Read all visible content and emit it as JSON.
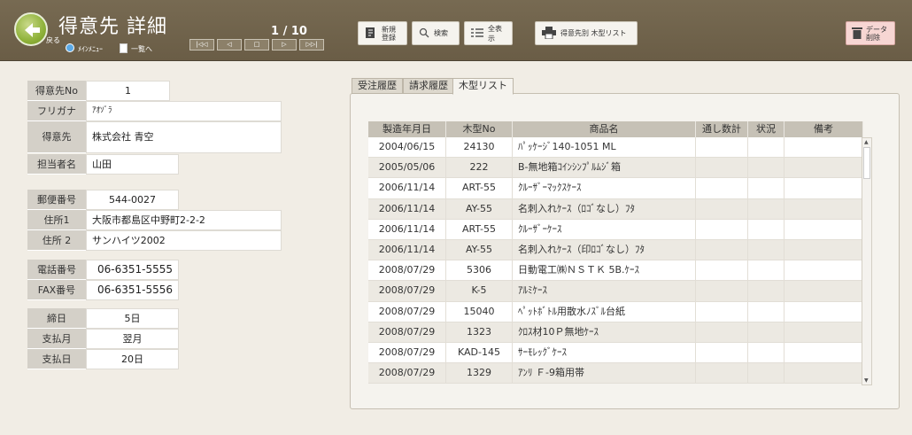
{
  "header": {
    "title": "得意先  詳細",
    "back_label": "戻る",
    "menu_link": "ﾒｲﾝﾒﾆｭｰ",
    "list_link": "一覧へ",
    "counter": "1 / 10",
    "pager": [
      "|◁◁",
      "◁",
      "□",
      "▷",
      "▷▷|"
    ],
    "new_btn": [
      "新規",
      "登録"
    ],
    "search_btn": "検索",
    "show_all_btn": "全表示",
    "print_btn": "得意先別 木型リスト",
    "delete_btn": [
      "データ",
      "削除"
    ]
  },
  "customer": {
    "no_label": "得意先No",
    "no": "1",
    "kana_label": "フリガナ",
    "kana": "ｱｵｿﾞﾗ",
    "name_label": "得意先",
    "name": "株式会社 青空",
    "staff_label": "担当者名",
    "staff": "山田",
    "zip_label": "郵便番号",
    "zip": "544-0027",
    "addr1_label": "住所1",
    "addr1": "大阪市都島区中野町2-2-2",
    "addr2_label": "住所 2",
    "addr2": "サンハイツ2002",
    "tel_label": "電話番号",
    "tel": "06-6351-5555",
    "fax_label": "FAX番号",
    "fax": "06-6351-5556",
    "closing_label": "締日",
    "closing": "5日",
    "paymonth_label": "支払月",
    "paymonth": "翌月",
    "payday_label": "支払日",
    "payday": "20日"
  },
  "tabs": [
    "受注履歴",
    "請求履歴",
    "木型リスト"
  ],
  "table": {
    "headers": [
      "製造年月日",
      "木型No",
      "商品名",
      "通し数計",
      "状況",
      "備考"
    ],
    "rows": [
      [
        "2004/06/15",
        "24130",
        "ﾊﾟｯｹｰｼﾞ140-1051 ML",
        "",
        "",
        ""
      ],
      [
        "2005/05/06",
        "222",
        "B-無地箱ｺｲﾝｼﾝﾌﾟﾙﾑｼﾞ箱",
        "",
        "",
        ""
      ],
      [
        "2006/11/14",
        "ART-55",
        "ｸﾙｰｻﾞｰﾏｯｸｽｹｰｽ",
        "",
        "",
        ""
      ],
      [
        "2006/11/14",
        "AY-55",
        "名刺入れｹｰｽ（ﾛｺﾞなし）ﾌﾀ",
        "",
        "",
        ""
      ],
      [
        "2006/11/14",
        "ART-55",
        "ｸﾙｰｻﾞｰｹｰｽ",
        "",
        "",
        ""
      ],
      [
        "2006/11/14",
        "AY-55",
        "名刺入れｹｰｽ（印ﾛｺﾞなし）ﾌﾀ",
        "",
        "",
        ""
      ],
      [
        "2008/07/29",
        "5306",
        "日動電工㈱ＮＳＴＫ 5B.ｹｰｽ",
        "",
        "",
        ""
      ],
      [
        "2008/07/29",
        "K-5",
        "ｱﾙﾐｹｰｽ",
        "",
        "",
        ""
      ],
      [
        "2008/07/29",
        "15040",
        "ﾍﾟｯﾄﾎﾞﾄﾙ用散水ﾉｽﾞﾙ台紙",
        "",
        "",
        ""
      ],
      [
        "2008/07/29",
        "1323",
        "ｸﾛｽ材10Ｐ無地ｹｰｽ",
        "",
        "",
        ""
      ],
      [
        "2008/07/29",
        "KAD-145",
        "ｻｰﾓﾚｯｸﾞｹｰｽ",
        "",
        "",
        ""
      ],
      [
        "2008/07/29",
        "1329",
        "ｱﾝﾘ Ｆ-9箱用帯",
        "",
        "",
        ""
      ]
    ]
  },
  "colors": {
    "header_bg": "#6f624b",
    "delete_bg": "#f7d6d3",
    "back_green": "#8fb23a"
  }
}
